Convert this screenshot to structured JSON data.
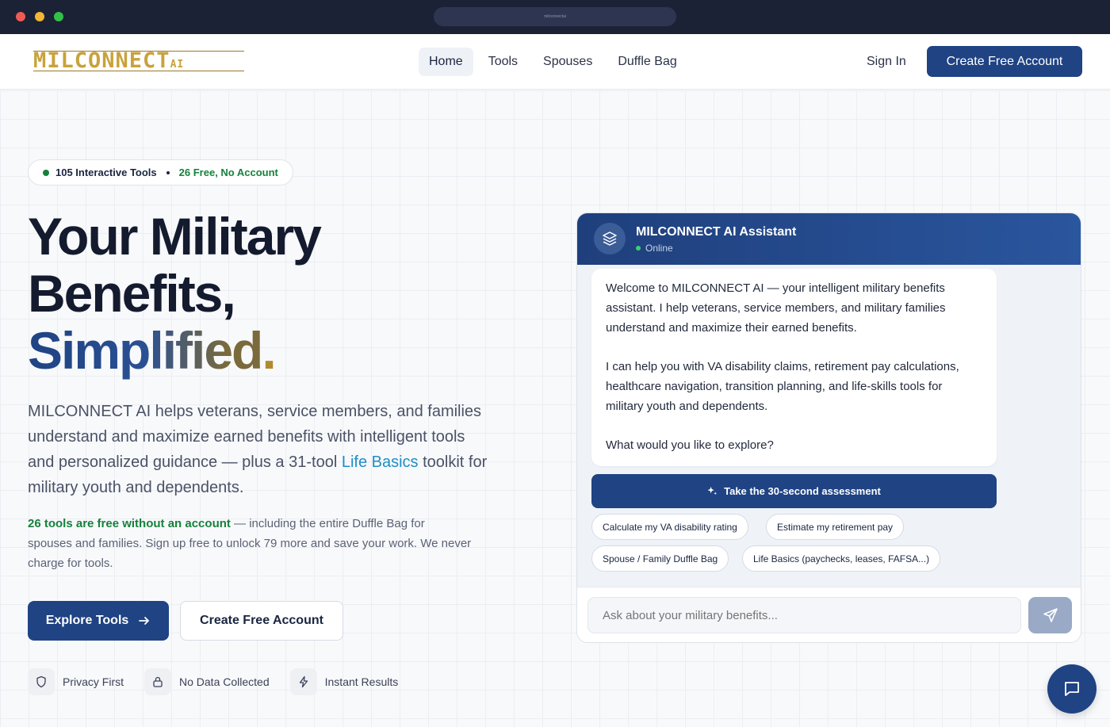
{
  "browser": {
    "url": "milconnectai"
  },
  "header": {
    "logo_text": "MILCONNECT",
    "logo_suffix": "AI",
    "nav": [
      {
        "label": "Home",
        "active": true
      },
      {
        "label": "Tools"
      },
      {
        "label": "Spouses"
      },
      {
        "label": "Duffle Bag"
      }
    ],
    "sign_in": "Sign In",
    "cta": "Create Free Account"
  },
  "hero": {
    "pill_tools": "105 Interactive Tools",
    "pill_free": "26 Free, No Account",
    "title_line1": "Your Military",
    "title_line2": "Benefits,",
    "title_line3": "Simplified",
    "title_period": ".",
    "lead_before": "MILCONNECT AI helps veterans, service members, and families understand and maximize earned benefits with intelligent tools and personalized guidance — plus a 31-tool ",
    "lead_link": "Life Basics",
    "lead_after": " toolkit for military youth and dependents.",
    "sub_bold": "26 tools are free without an account",
    "sub_rest": " — including the entire Duffle Bag for spouses and families. Sign up free to unlock 79 more and save your work. We never charge for tools.",
    "explore_btn": "Explore Tools",
    "create_btn": "Create Free Account",
    "badges": [
      {
        "icon": "shield-icon",
        "label": "Privacy First"
      },
      {
        "icon": "lock-icon",
        "label": "No Data Collected"
      },
      {
        "icon": "bolt-icon",
        "label": "Instant Results"
      }
    ]
  },
  "chat": {
    "title": "MILCONNECT AI Assistant",
    "status": "Online",
    "message": [
      "Welcome to MILCONNECT AI — your intelligent military benefits assistant. I help veterans, service members, and military families understand and maximize their earned benefits.",
      "I can help you with VA disability claims, retirement pay calculations, healthcare navigation, transition planning, and life-skills tools for military youth and dependents.",
      "What would you like to explore?"
    ],
    "assessment_btn": "Take the 30-second assessment",
    "chips": [
      "Calculate my VA disability rating",
      "Estimate my retirement pay",
      "Spouse / Family Duffle Bag",
      "Life Basics (paychecks, leases, FAFSA...)"
    ],
    "input_placeholder": "Ask about your military benefits..."
  },
  "colors": {
    "brand": "#1f4383",
    "success": "#16813b",
    "link": "#1f8ec6"
  }
}
